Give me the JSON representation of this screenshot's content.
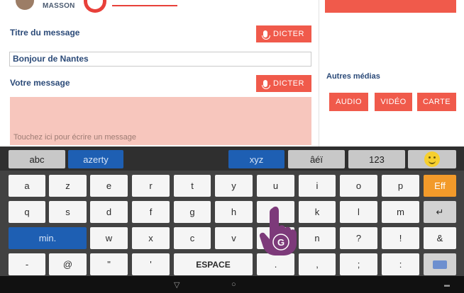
{
  "app": {
    "sender_name": "MASSON",
    "title_label": "Titre du message",
    "dicter_label": "DICTER",
    "title_value": "Bonjour de Nantes",
    "message_label": "Votre message",
    "message_placeholder": "Touchez ici pour écrire un message",
    "other_media_label": "Autres médias",
    "media_buttons": [
      "AUDIO",
      "VIDÉO",
      "CARTE"
    ]
  },
  "keyboard": {
    "modes": [
      "abc",
      "azerty",
      "xyz",
      "âéï",
      "123"
    ],
    "row1": [
      "a",
      "z",
      "e",
      "r",
      "t",
      "y",
      "u",
      "i",
      "o",
      "p",
      "Eff"
    ],
    "row2": [
      "q",
      "s",
      "d",
      "f",
      "g",
      "h",
      "j",
      "k",
      "l",
      "m",
      "↵"
    ],
    "row3": [
      "min.",
      "w",
      "x",
      "c",
      "v",
      "b",
      "n",
      "?",
      "!",
      "&"
    ],
    "row4": [
      "-",
      "@",
      "\"",
      "'",
      "ESPACE",
      ".",
      ",",
      ";",
      ":"
    ],
    "badge": "G"
  },
  "colors": {
    "accent": "#f05a4b",
    "label": "#2b4a78",
    "message_area": "#f7c6bd",
    "keyboard_bg": "#424242",
    "key_blue": "#1e5fb3",
    "key_orange": "#f29a2a"
  }
}
